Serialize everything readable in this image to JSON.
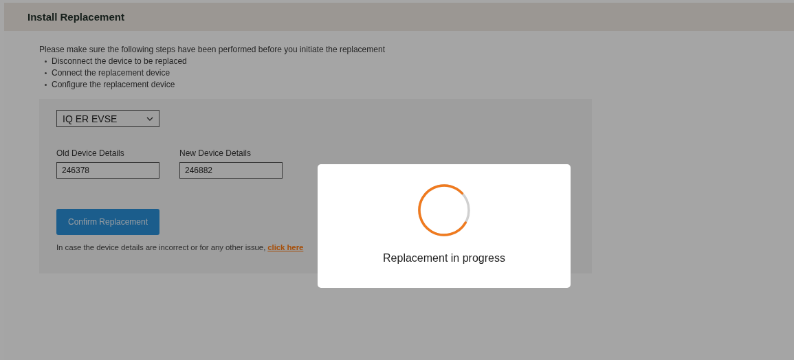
{
  "header": {
    "title": "Install Replacement"
  },
  "intro": "Please make sure the following steps have been performed before you initiate the replacement",
  "steps": [
    "Disconnect the device to be replaced",
    "Connect the replacement device",
    "Configure the replacement device"
  ],
  "device_select": {
    "value": "IQ ER EVSE"
  },
  "fields": [
    {
      "label": "Old Device Details",
      "value": "246378"
    },
    {
      "label": "New Device Details",
      "value": "246882"
    }
  ],
  "confirm_button": "Confirm Replacement",
  "help": {
    "text": "In case the device details are incorrect or for any other issue,",
    "link": "click here"
  },
  "modal": {
    "message": "Replacement in progress"
  }
}
